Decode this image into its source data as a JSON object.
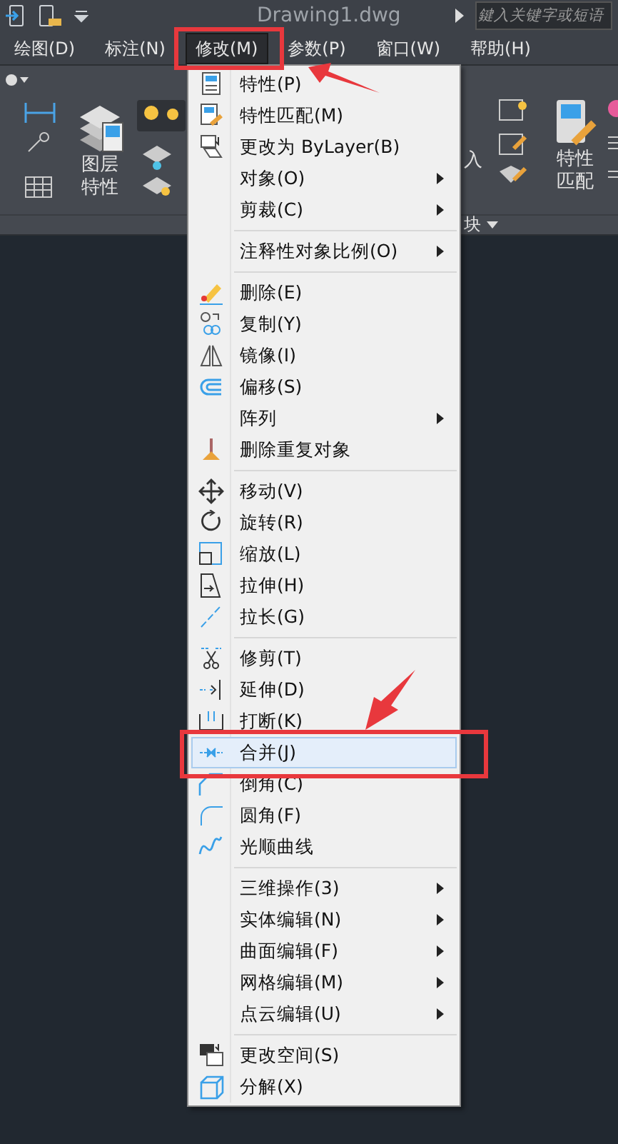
{
  "title_bar": {
    "title": "Drawing1.dwg",
    "search": {
      "placeholder": "鍵入关键字或短语"
    }
  },
  "menu_bar": [
    {
      "label": "绘图(D)",
      "selected": false
    },
    {
      "label": "标注(N)",
      "selected": false
    },
    {
      "label": "修改(M)",
      "selected": true
    },
    {
      "label": "参数(P)",
      "selected": false
    },
    {
      "label": "窗口(W)",
      "selected": false
    },
    {
      "label": "帮助(H)",
      "selected": false
    }
  ],
  "ribbon": {
    "layer_button": "图层特性",
    "insert_fragment": "入",
    "block_panel": "块",
    "match_button": "特性匹配"
  },
  "dropdown": [
    [
      {
        "label": "特性(P)",
        "submenu": false,
        "selected": false
      },
      {
        "label": "特性匹配(M)",
        "submenu": false,
        "selected": false
      },
      {
        "label": "更改为 ByLayer(B)",
        "submenu": false,
        "selected": false
      },
      {
        "label": "对象(O)",
        "submenu": true,
        "selected": false
      },
      {
        "label": "剪裁(C)",
        "submenu": true,
        "selected": false
      }
    ],
    [
      {
        "label": "注释性对象比例(O)",
        "submenu": true,
        "selected": false
      }
    ],
    [
      {
        "label": "删除(E)",
        "submenu": false,
        "selected": false
      },
      {
        "label": "复制(Y)",
        "submenu": false,
        "selected": false
      },
      {
        "label": "镜像(I)",
        "submenu": false,
        "selected": false
      },
      {
        "label": "偏移(S)",
        "submenu": false,
        "selected": false
      },
      {
        "label": "阵列",
        "submenu": true,
        "selected": false
      },
      {
        "label": "删除重复对象",
        "submenu": false,
        "selected": false
      }
    ],
    [
      {
        "label": "移动(V)",
        "submenu": false,
        "selected": false
      },
      {
        "label": "旋转(R)",
        "submenu": false,
        "selected": false
      },
      {
        "label": "缩放(L)",
        "submenu": false,
        "selected": false
      },
      {
        "label": "拉伸(H)",
        "submenu": false,
        "selected": false
      },
      {
        "label": "拉长(G)",
        "submenu": false,
        "selected": false
      }
    ],
    [
      {
        "label": "修剪(T)",
        "submenu": false,
        "selected": false
      },
      {
        "label": "延伸(D)",
        "submenu": false,
        "selected": false
      },
      {
        "label": "打断(K)",
        "submenu": false,
        "selected": false
      },
      {
        "label": "合并(J)",
        "submenu": false,
        "selected": true
      },
      {
        "label": "倒角(C)",
        "submenu": false,
        "selected": false
      },
      {
        "label": "圆角(F)",
        "submenu": false,
        "selected": false
      },
      {
        "label": "光顺曲线",
        "submenu": false,
        "selected": false
      }
    ],
    [
      {
        "label": "三维操作(3)",
        "submenu": true,
        "selected": false
      },
      {
        "label": "实体编辑(N)",
        "submenu": true,
        "selected": false
      },
      {
        "label": "曲面编辑(F)",
        "submenu": true,
        "selected": false
      },
      {
        "label": "网格编辑(M)",
        "submenu": true,
        "selected": false
      },
      {
        "label": "点云编辑(U)",
        "submenu": true,
        "selected": false
      }
    ],
    [
      {
        "label": "更改空间(S)",
        "submenu": false,
        "selected": false
      },
      {
        "label": "分解(X)",
        "submenu": false,
        "selected": false
      }
    ]
  ]
}
